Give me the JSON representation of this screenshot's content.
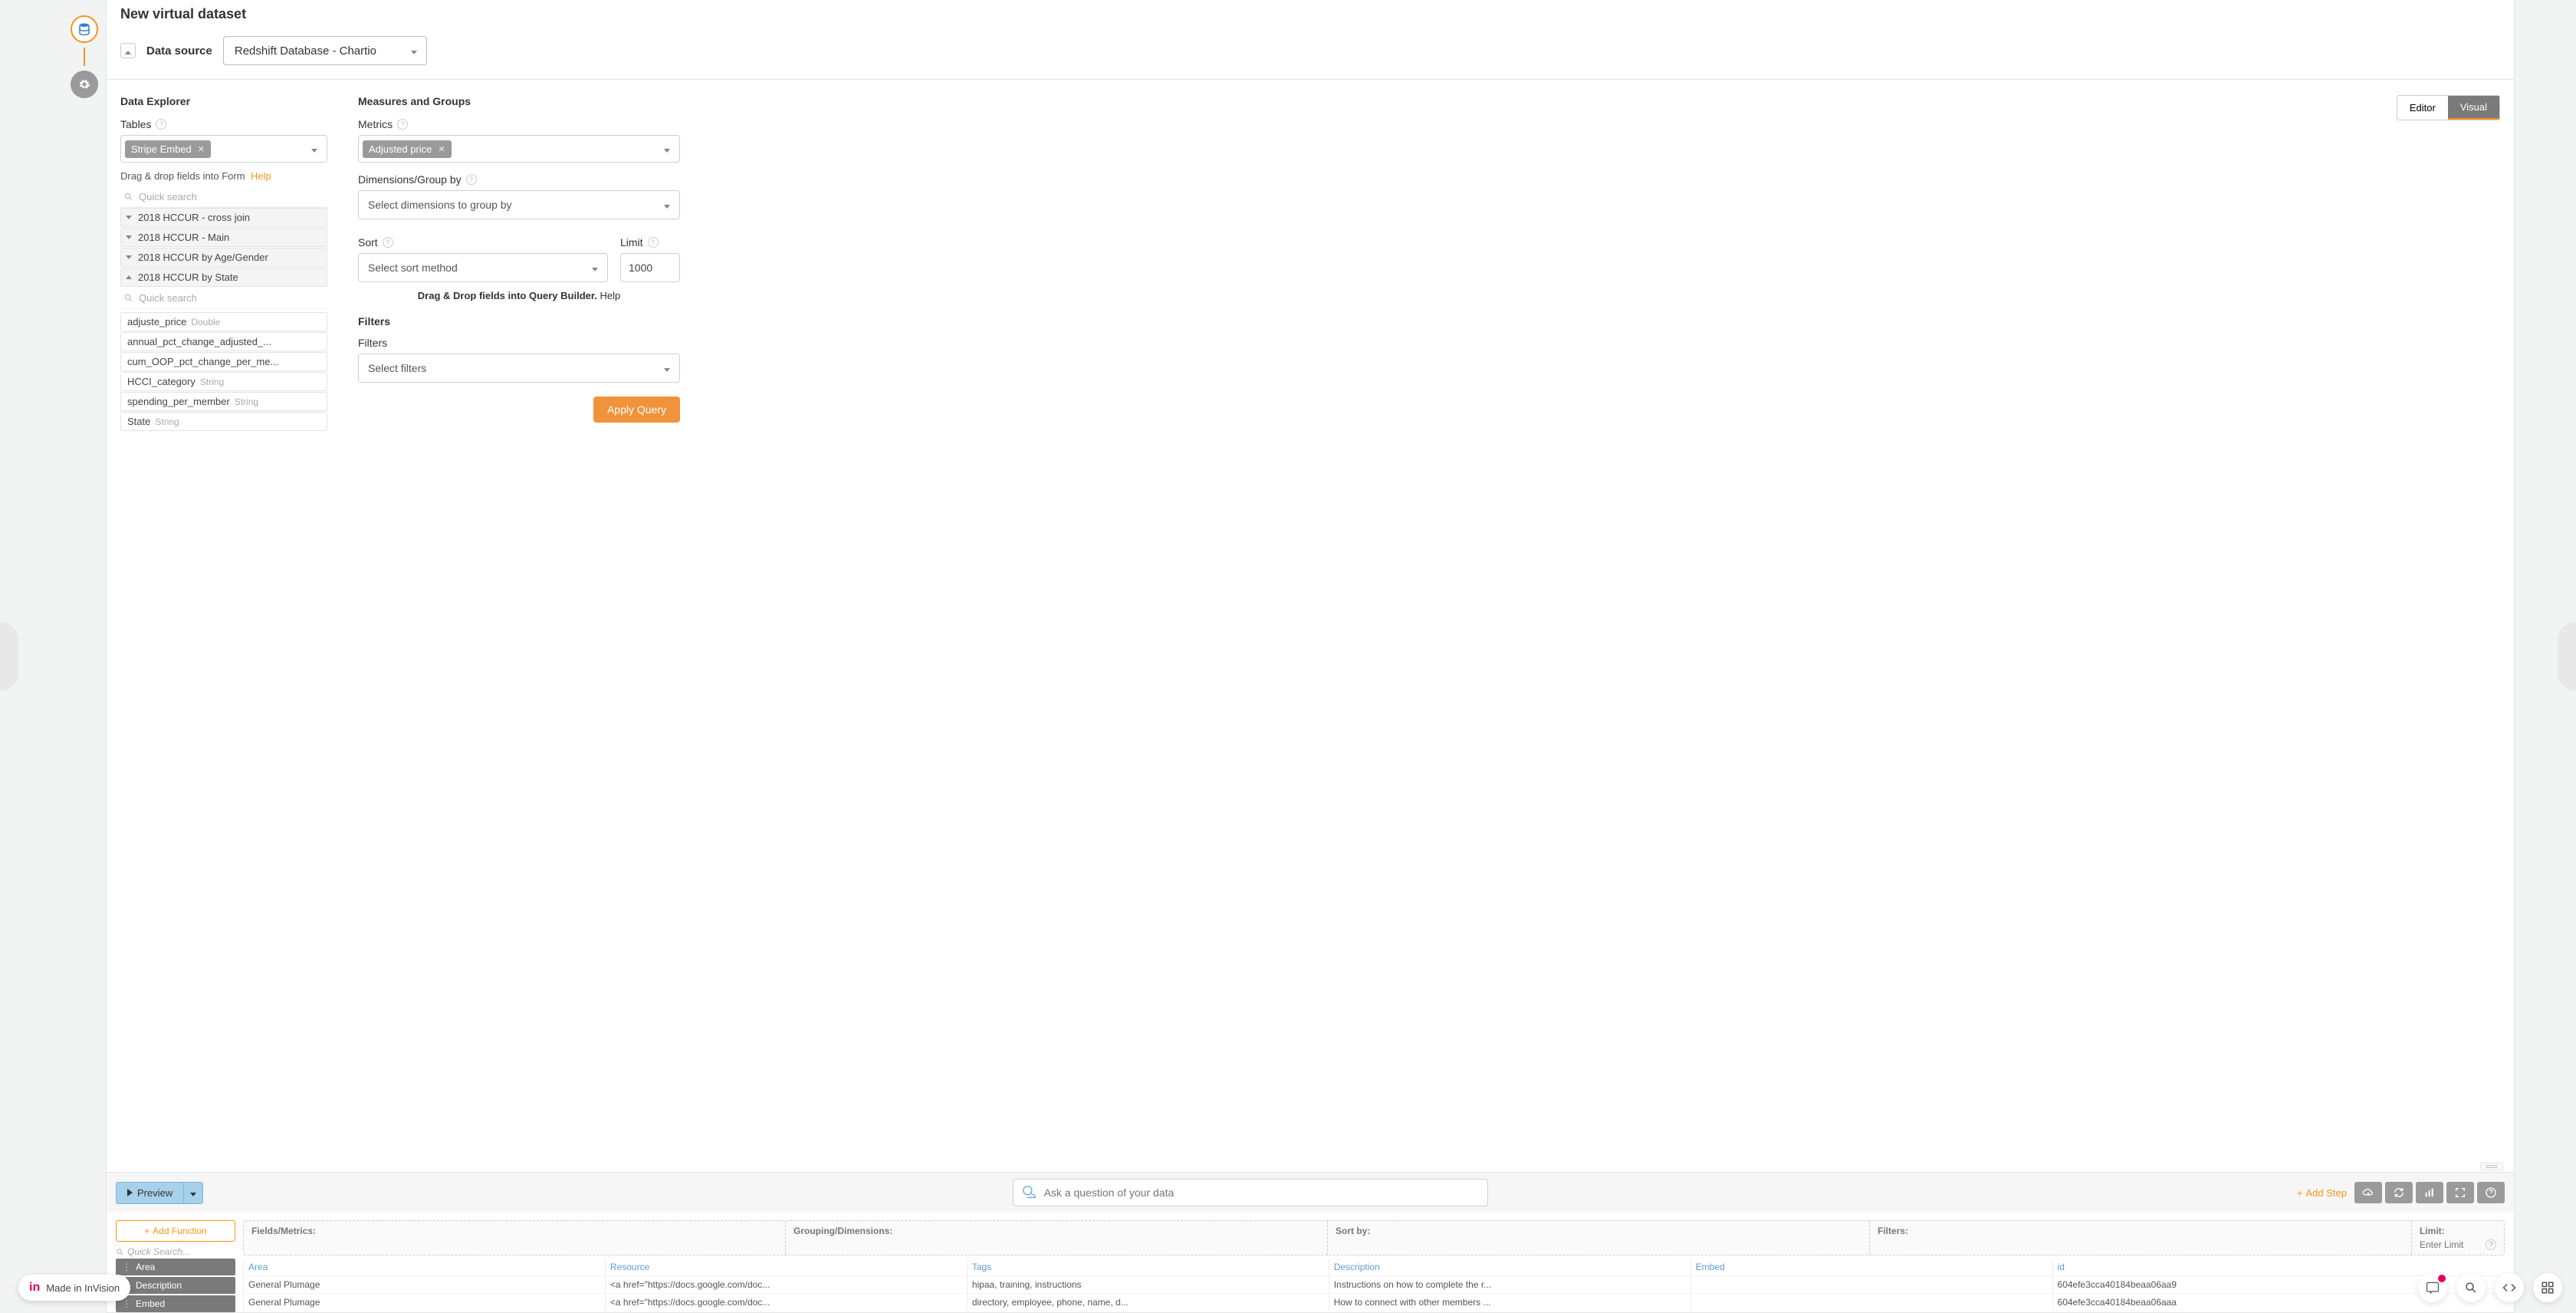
{
  "page": {
    "title": "New virtual dataset"
  },
  "datasource": {
    "label": "Data source",
    "selected": "Redshift Database - Chartio"
  },
  "explorer": {
    "header": "Data Explorer",
    "tables_label": "Tables",
    "tables_chip": "Stripe Embed",
    "hint_text": "Drag & drop fields into Form",
    "hint_help": "Help",
    "quick_search": "Quick search",
    "tree": [
      {
        "label": "2018 HCCUR - cross join",
        "open": false
      },
      {
        "label": "2018 HCCUR - Main",
        "open": false
      },
      {
        "label": "2018 HCCUR by Age/Gender",
        "open": false
      },
      {
        "label": "2018 HCCUR by State",
        "open": true
      }
    ],
    "fields": [
      {
        "name": "adjuste_price",
        "type": "Double"
      },
      {
        "name": "annual_pct_change_adjusted_...",
        "type": ""
      },
      {
        "name": "cum_OOP_pct_change_per_me...",
        "type": ""
      },
      {
        "name": "HCCI_category",
        "type": "String"
      },
      {
        "name": "spending_per_member",
        "type": "String"
      },
      {
        "name": "State",
        "type": "String"
      }
    ]
  },
  "measures": {
    "header": "Measures and Groups",
    "metrics_label": "Metrics",
    "metrics_chip": "Adjusted price",
    "dimensions_label": "Dimensions/Group by",
    "dimensions_placeholder": "Select dimensions to group by",
    "sort_label": "Sort",
    "sort_placeholder": "Select sort method",
    "limit_label": "Limit",
    "limit_value": "1000",
    "dnd_hint": "Drag & Drop fields into Query Builder.",
    "dnd_help": "Help",
    "filters_header": "Filters",
    "filters_label": "Filters",
    "filters_placeholder": "Select filters",
    "apply_btn": "Apply Query"
  },
  "mode": {
    "editor": "Editor",
    "visual": "Visual"
  },
  "toolbar": {
    "preview": "Preview",
    "ask_placeholder": "Ask a question of your data",
    "add_step": "Add Step"
  },
  "results": {
    "add_function": "Add Function",
    "quick_search": "Quick Search...",
    "funcs": [
      "Area",
      "Description",
      "Embed"
    ],
    "dz_labels": {
      "fields": "Fields/Metrics:",
      "grouping": "Grouping/Dimensions:",
      "sort": "Sort by:",
      "filters": "Filters:",
      "limit": "Limit:",
      "limit_placeholder": "Enter Limit"
    },
    "columns": [
      "Area",
      "Resource",
      "Tags",
      "Description",
      "Embed",
      "id"
    ],
    "rows": [
      {
        "Area": "General Plumage",
        "Resource": "<a href=\"https://docs.google.com/doc...",
        "Tags": "hipaa, training, instructions",
        "Description": "Instructions on how to complete the r...",
        "Embed": "",
        "id": "604efe3cca40184beaa06aa9"
      },
      {
        "Area": "General Plumage",
        "Resource": "<a href=\"https://docs.google.com/doc...",
        "Tags": "directory, employee, phone, name, d...",
        "Description": "How to connect with other members ...",
        "Embed": "",
        "id": "604efe3cca40184beaa06aaa"
      }
    ]
  },
  "invision": {
    "label": "Made in InVision"
  }
}
